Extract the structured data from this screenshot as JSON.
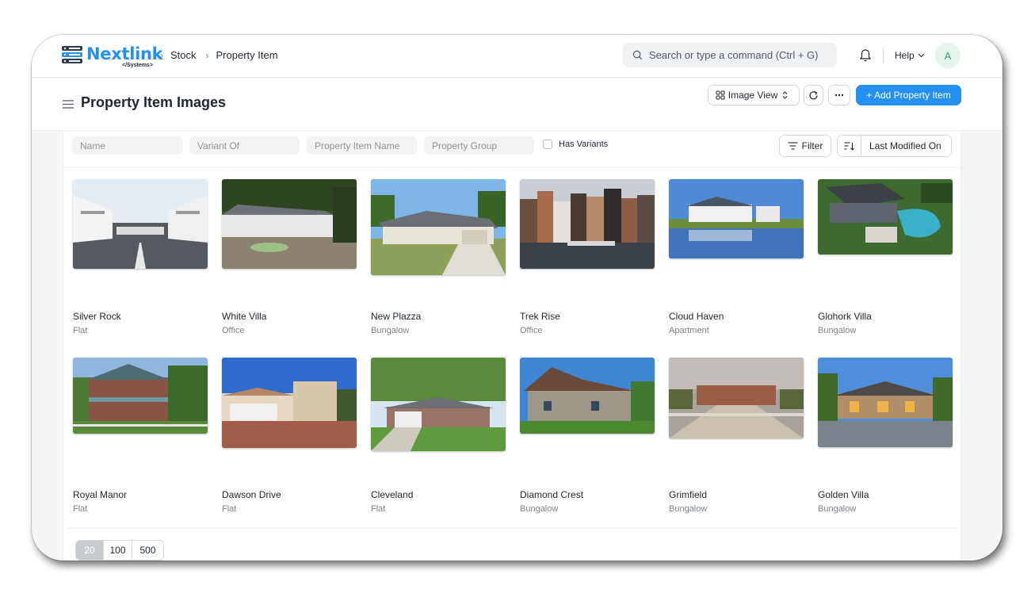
{
  "navbar": {
    "logo_text": "Nextlink",
    "logo_sub": "</Systems>",
    "breadcrumbs": [
      "Stock",
      "Property Item"
    ],
    "search_placeholder": "Search or type a command (Ctrl + G)",
    "help_label": "Help",
    "avatar_letter": "A"
  },
  "page": {
    "title": "Property Item Images",
    "view_label": "Image View",
    "add_label": "+ Add Property Item"
  },
  "filters": {
    "name_placeholder": "Name",
    "variant_placeholder": "Variant Of",
    "item_name_placeholder": "Property Item Name",
    "group_placeholder": "Property Group",
    "has_variants_label": "Has Variants",
    "filter_label": "Filter",
    "sort_label": "Last Modified On"
  },
  "items": [
    {
      "name": "Silver Rock",
      "type": "Flat"
    },
    {
      "name": "White Villa",
      "type": "Office"
    },
    {
      "name": "New Plazza",
      "type": "Bungalow"
    },
    {
      "name": "Trek Rise",
      "type": "Office"
    },
    {
      "name": "Cloud Haven",
      "type": "Apartment"
    },
    {
      "name": "Glohork Villa",
      "type": "Bungalow"
    },
    {
      "name": "Royal Manor",
      "type": "Flat"
    },
    {
      "name": "Dawson Drive",
      "type": "Flat"
    },
    {
      "name": "Cleveland",
      "type": "Flat"
    },
    {
      "name": "Diamond Crest",
      "type": "Bungalow"
    },
    {
      "name": "Grimfield",
      "type": "Bungalow"
    },
    {
      "name": "Golden Villa",
      "type": "Bungalow"
    }
  ],
  "pager": [
    "20",
    "100",
    "500"
  ],
  "colors": {
    "accent": "#2490ef",
    "title": "#1f272e",
    "muted": "#7c8389"
  }
}
